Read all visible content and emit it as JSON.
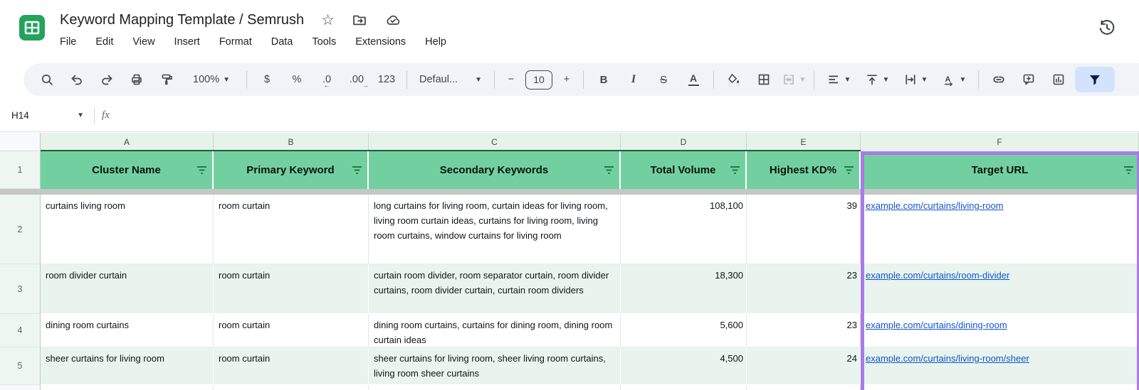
{
  "window": {
    "title": "Keyword Mapping Template / Semrush",
    "menus": [
      "File",
      "Edit",
      "View",
      "Insert",
      "Format",
      "Data",
      "Tools",
      "Extensions",
      "Help"
    ]
  },
  "toolbar": {
    "zoom": "100%",
    "currency": "$",
    "percent": "%",
    "decrease_decimal": ".0",
    "increase_decimal": ".00",
    "more_formats": "123",
    "font_name": "Defaul...",
    "decrease_font": "−",
    "font_size": "10",
    "increase_font": "+",
    "bold": "B",
    "italic": "I",
    "strikethrough": "S",
    "text_color": "A"
  },
  "formula_bar": {
    "name_box": "H14",
    "fx": "fx"
  },
  "sheet": {
    "header_row_num": "1",
    "columns": [
      {
        "letter": "A",
        "header": "Cluster Name"
      },
      {
        "letter": "B",
        "header": "Primary Keyword"
      },
      {
        "letter": "C",
        "header": "Secondary Keywords"
      },
      {
        "letter": "D",
        "header": "Total Volume"
      },
      {
        "letter": "E",
        "header": "Highest KD%"
      },
      {
        "letter": "F",
        "header": "Target URL"
      }
    ],
    "rows": [
      {
        "num": "2",
        "cluster_name": "curtains living room",
        "primary_keyword": "room curtain",
        "secondary_keywords": "long curtains for living room, curtain ideas for living room, living room curtain ideas, curtains for living room, living room curtains, window curtains for living room",
        "total_volume": "108,100",
        "highest_kd": "39",
        "target_url": "example.com/curtains/living-room"
      },
      {
        "num": "3",
        "cluster_name": "room divider curtain",
        "primary_keyword": "room curtain",
        "secondary_keywords": "curtain room divider, room separator curtain, room divider curtains, room divider curtain, curtain room dividers",
        "total_volume": "18,300",
        "highest_kd": "23",
        "target_url": "example.com/curtains/room-divider"
      },
      {
        "num": "4",
        "cluster_name": "dining room curtains",
        "primary_keyword": "room curtain",
        "secondary_keywords": "dining room curtains, curtains for dining room, dining room curtain ideas",
        "total_volume": "5,600",
        "highest_kd": "23",
        "target_url": "example.com/curtains/dining-room"
      },
      {
        "num": "5",
        "cluster_name": "sheer curtains for living room",
        "primary_keyword": "room curtain",
        "secondary_keywords": "sheer curtains for living room, sheer living room curtains, living room sheer curtains",
        "total_volume": "4,500",
        "highest_kd": "24",
        "target_url": "example.com/curtains/living-room/sheer"
      }
    ]
  },
  "colors": {
    "header_green": "#72d0a0",
    "banded_row_green": "#e8f4ed",
    "column_strip_green": "#e7f2ea",
    "row_header_green": "#eef6f1",
    "frozen_divider_green": "#1e5e3a",
    "filter_glyph_green": "#1b7d43",
    "selection_purple": "#ab79ea",
    "link_blue": "#1155cc",
    "toolbar_bg": "#f0f4f9",
    "active_filter_bg": "#d3e3fd",
    "active_filter_glyph": "#041e49",
    "freeze_band_gray": "#c4c7c5",
    "logo_green": "#23a45d"
  }
}
